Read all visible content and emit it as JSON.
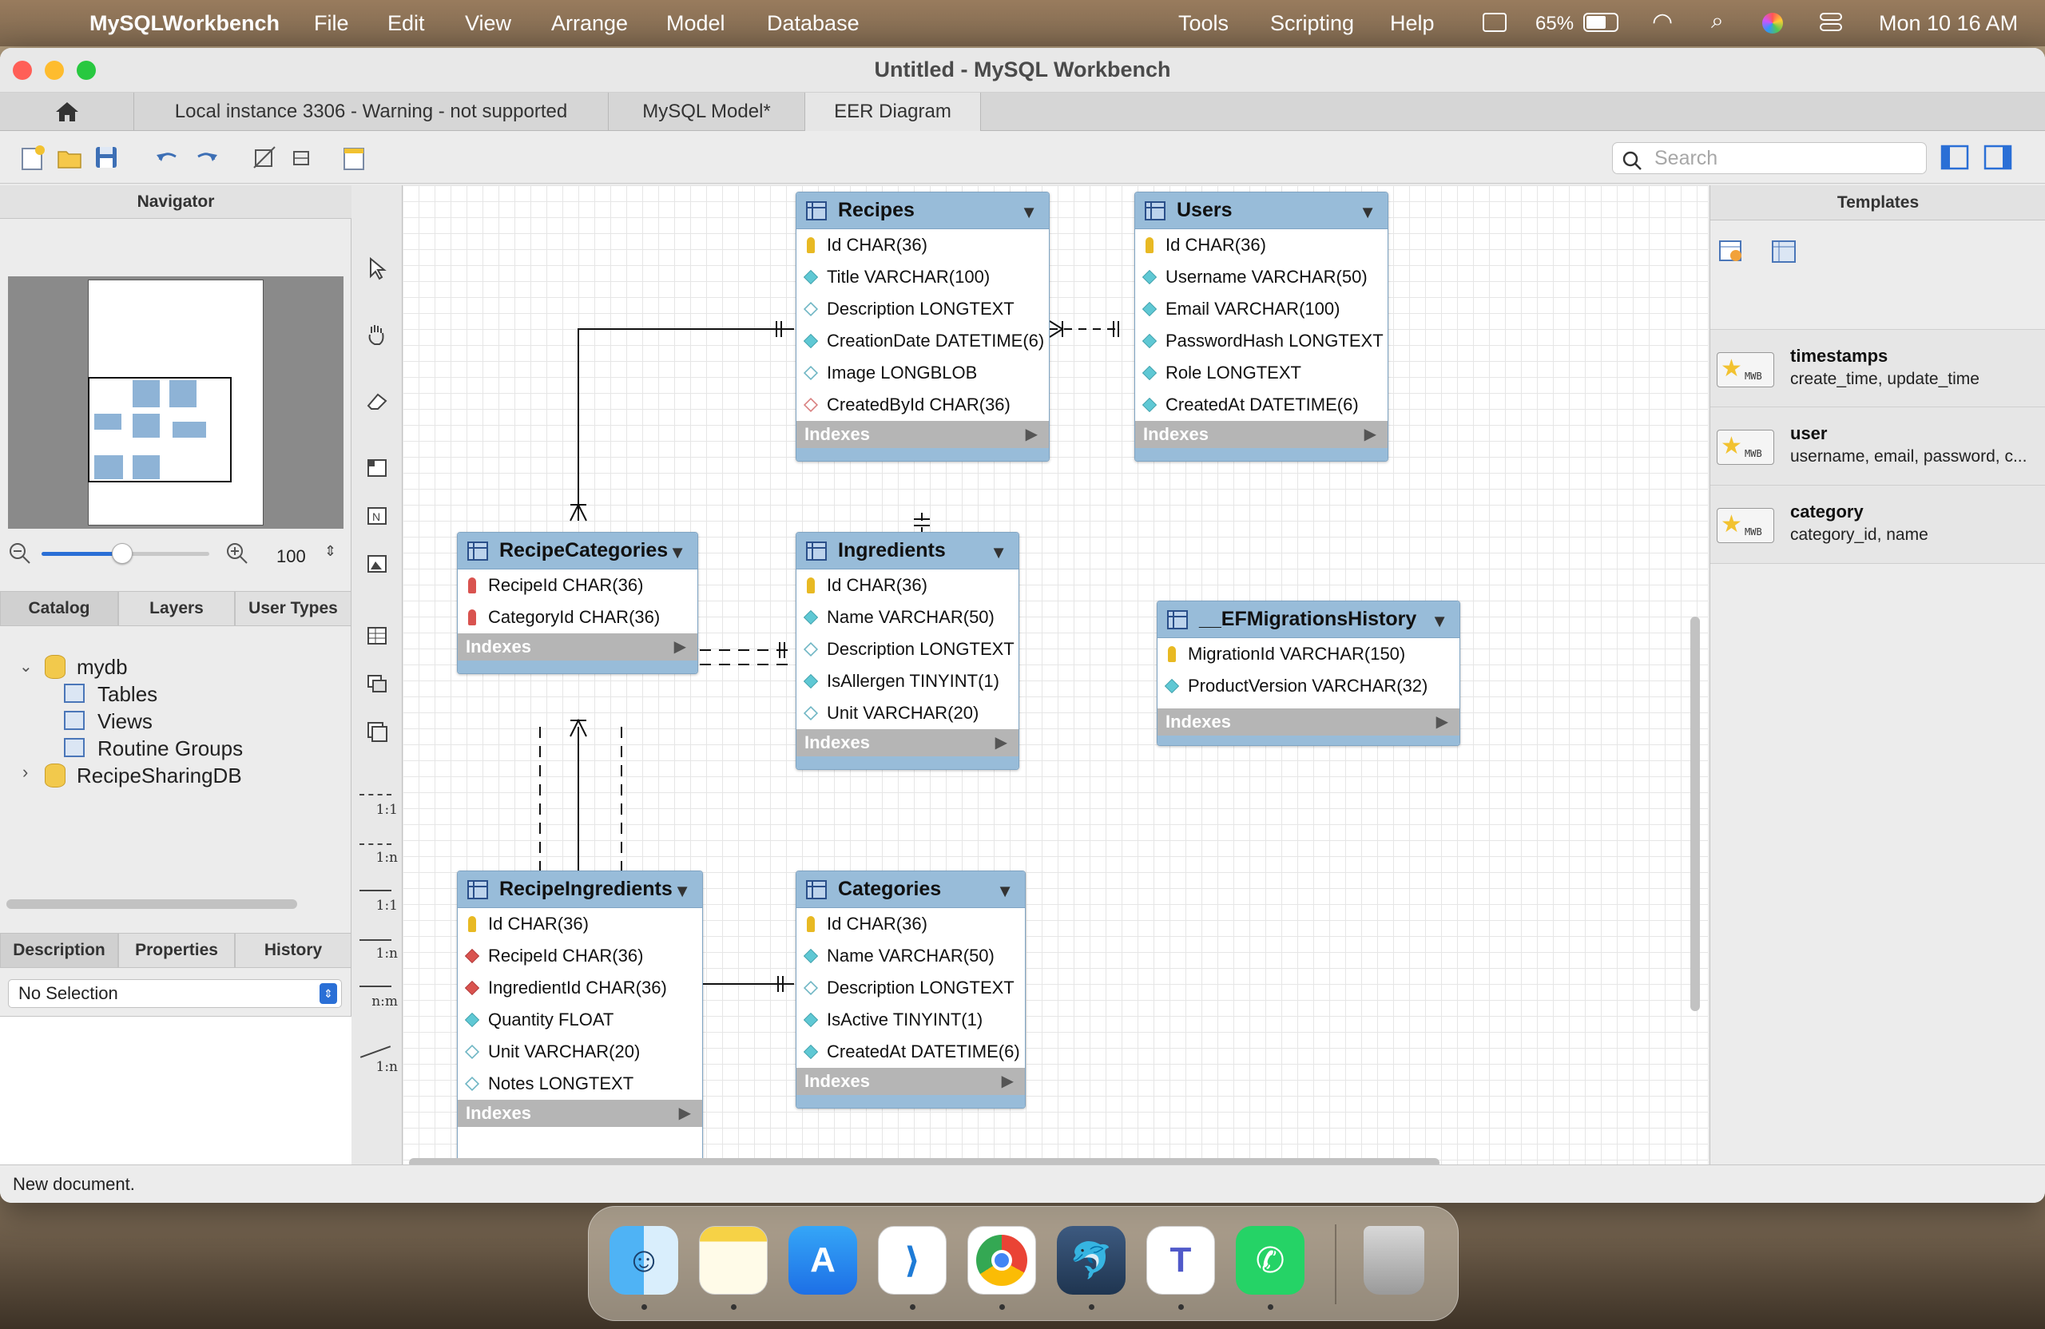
{
  "menubar": {
    "app_name": "MySQLWorkbench",
    "menus": [
      "File",
      "Edit",
      "View",
      "Arrange",
      "Model",
      "Database",
      "Tools",
      "Scripting",
      "Help"
    ],
    "battery": "65%",
    "clock": "Mon 10 16 AM"
  },
  "window": {
    "title": "Untitled - MySQL Workbench"
  },
  "tabs": [
    {
      "label": "Local instance 3306 - Warning - not supported"
    },
    {
      "label": "MySQL Model*"
    },
    {
      "label": "EER Diagram"
    }
  ],
  "toolbar": {
    "search_placeholder": "Search"
  },
  "navigator": {
    "title": "Navigator",
    "zoom": "100"
  },
  "catalog_tabs": [
    "Catalog",
    "Layers",
    "User Types"
  ],
  "tree": {
    "db1": "mydb",
    "tables": "Tables",
    "views": "Views",
    "routines": "Routine Groups",
    "db2": "RecipeSharingDB"
  },
  "bottom_tabs": [
    "Description",
    "Properties",
    "History"
  ],
  "selection": "No Selection",
  "palette_labels": [
    "1:1",
    "1:n",
    "1:1",
    "1:n",
    "n:m",
    "1:n"
  ],
  "tables": {
    "recipes": {
      "name": "Recipes",
      "cols": [
        "Id CHAR(36)",
        "Title VARCHAR(100)",
        "Description LONGTEXT",
        "CreationDate DATETIME(6)",
        "Image LONGBLOB",
        "CreatedById CHAR(36)"
      ],
      "indexes": "Indexes"
    },
    "users": {
      "name": "Users",
      "cols": [
        "Id CHAR(36)",
        "Username VARCHAR(50)",
        "Email VARCHAR(100)",
        "PasswordHash LONGTEXT",
        "Role LONGTEXT",
        "CreatedAt DATETIME(6)"
      ],
      "indexes": "Indexes"
    },
    "recipecategories": {
      "name": "RecipeCategories",
      "cols": [
        "RecipeId CHAR(36)",
        "CategoryId CHAR(36)"
      ],
      "indexes": "Indexes"
    },
    "ingredients": {
      "name": "Ingredients",
      "cols": [
        "Id CHAR(36)",
        "Name VARCHAR(50)",
        "Description LONGTEXT",
        "IsAllergen TINYINT(1)",
        "Unit VARCHAR(20)"
      ],
      "indexes": "Indexes"
    },
    "efmigrations": {
      "name": "__EFMigrationsHistory",
      "cols": [
        "MigrationId VARCHAR(150)",
        "ProductVersion VARCHAR(32)"
      ],
      "indexes": "Indexes"
    },
    "recipeingredients": {
      "name": "RecipeIngredients",
      "cols": [
        "Id CHAR(36)",
        "RecipeId CHAR(36)",
        "IngredientId CHAR(36)",
        "Quantity FLOAT",
        "Unit VARCHAR(20)",
        "Notes LONGTEXT"
      ],
      "indexes": "Indexes"
    },
    "categories": {
      "name": "Categories",
      "cols": [
        "Id CHAR(36)",
        "Name VARCHAR(50)",
        "Description LONGTEXT",
        "IsActive TINYINT(1)",
        "CreatedAt DATETIME(6)"
      ],
      "indexes": "Indexes"
    }
  },
  "templates": {
    "title": "Templates",
    "items": [
      {
        "name": "timestamps",
        "desc": "create_time, update_time"
      },
      {
        "name": "user",
        "desc": "username, email, password, c..."
      },
      {
        "name": "category",
        "desc": "category_id, name"
      }
    ]
  },
  "status": "New document.",
  "colors": {
    "table_header": "#98bcd9",
    "accent": "#2a6fd6"
  }
}
